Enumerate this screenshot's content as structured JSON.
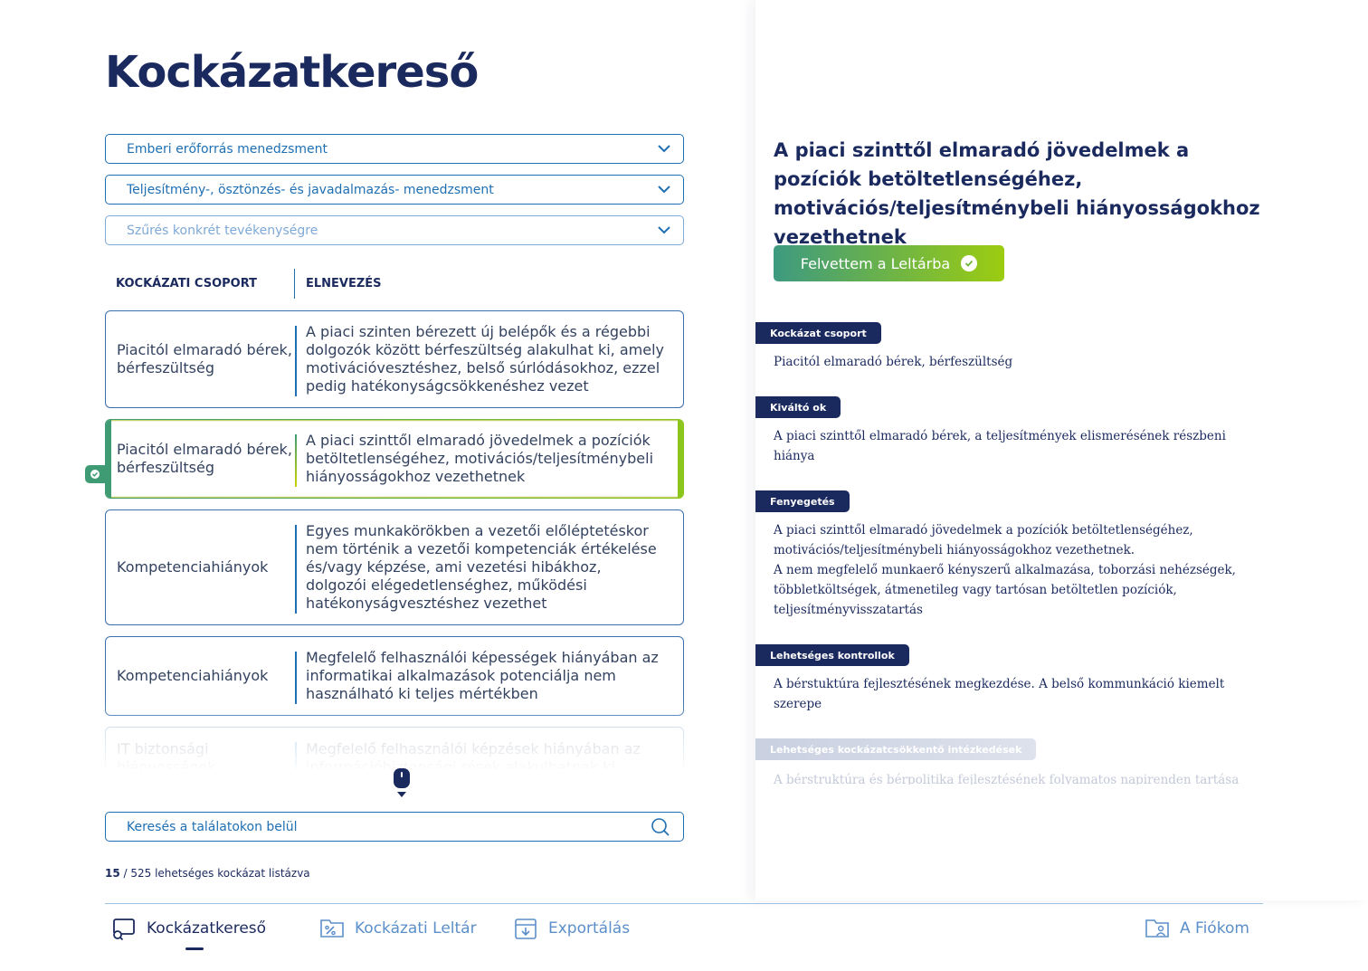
{
  "page": {
    "title": "Kockázatkereső"
  },
  "filters": [
    {
      "label": "Emberi erőforrás menedzsment"
    },
    {
      "label": "Teljesítmény-, ösztönzés- és javadalmazás- menedzsment"
    },
    {
      "label": "Szűrés konkrét tevékenységre"
    }
  ],
  "table": {
    "col_group": "KOCKÁZATI CSOPORT",
    "col_name": "ELNEVEZÉS",
    "rows": [
      {
        "group": "Piacitól elmaradó bérek, bérfeszültség",
        "name": "A piaci szinten bérezett új belépők és a régebbi dolgozók között bérfeszültség alakulhat ki, amely motivációvesztéshez, belső súrlódásokhoz, ezzel pedig hatékonyságcsökkenéshez vezet"
      },
      {
        "group": "Piacitól elmaradó bérek, bérfeszültség",
        "name": "A piaci szinttől elmaradó jövedelmek a pozíciók betöltetlenségéhez, motivációs/teljesítménybeli hiányosságokhoz vezethetnek",
        "selected": true
      },
      {
        "group": "Kompetenciahiányok",
        "name": "Egyes munkakörökben a vezetői előléptetéskor nem történik a vezetői kompetenciák értékelése és/vagy képzése, ami vezetési hibákhoz, dolgozói elégedetlenséghez, működési hatékonyságvesztéshez vezethet"
      },
      {
        "group": "Kompetenciahiányok",
        "name": "Megfelelő felhasználói képességek hiányában az informatikai alkalmazások potenciálja nem használható ki teljes mértékben"
      },
      {
        "group": "IT biztonsági hiányosságok",
        "name": "Megfelelő felhasználói képzések hiányában az információbiztonsági rések alakulhatnak ki"
      }
    ]
  },
  "search": {
    "placeholder": "Keresés a találatokon belül"
  },
  "count": {
    "shown": "15",
    "rest": " / 525 lehetséges kockázat listázva"
  },
  "detail": {
    "title": "A piaci szinttől elmaradó jövedelmek a pozíciók betöltetlenségéhez, motivációs/teljesítménybeli hiányosságokhoz vezethetnek",
    "add_button": "Felvettem a Leltárba",
    "sections": [
      {
        "label": "Kockázat csoport",
        "text": "Piacitól elmaradó bérek, bérfeszültség"
      },
      {
        "label": "Kiváltó ok",
        "text": "A piaci szinttől elmaradó bérek, a teljesítmények elismerésének részbeni hiánya"
      },
      {
        "label": "Fenyegetés",
        "text": "A piaci szinttől elmaradó jövedelmek a pozíciók betöltetlenségéhez, motivációs/teljesítménybeli hiányosságokhoz vezethetnek.",
        "text2": "A nem megfelelő munkaerő kényszerű alkalmazása, toborzási nehézségek, többletköltségek, átmenetileg vagy tartósan betöltetlen pozíciók, teljesítményvisszatartás"
      },
      {
        "label": "Lehetséges kontrollok",
        "text": "A bérstuktúra fejlesztésének megkezdése. A belső kommunkáció kiemelt szerepe"
      },
      {
        "label": "Lehetséges kockázatcsökkentő intézkedések",
        "text": "A bérstruktúra és bérpolitika fejlesztésének folyamatos napirenden tartása"
      }
    ]
  },
  "nav": {
    "search": "Kockázatkereső",
    "inventory": "Kockázati Leltár",
    "export": "Exportálás",
    "account": "A Fiókom"
  },
  "colors": {
    "navy": "#1b2a5e",
    "blue": "#1f6fb3",
    "green": "#3f9b73",
    "lime": "#8cc51c"
  }
}
